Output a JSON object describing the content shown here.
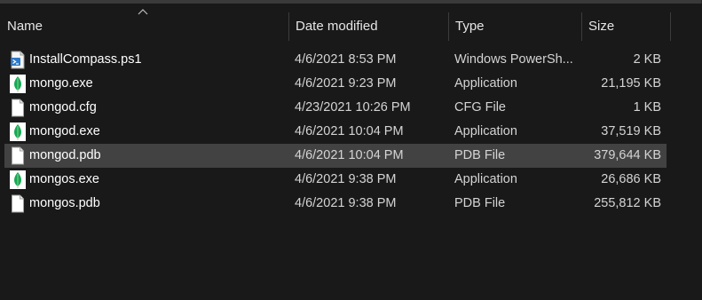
{
  "columns": {
    "name": "Name",
    "date_modified": "Date modified",
    "type": "Type",
    "size": "Size"
  },
  "sort": {
    "column": "Name",
    "direction": "ascending",
    "icon": "sort-up-arrow-icon"
  },
  "files": [
    {
      "name": "InstallCompass.ps1",
      "date": "4/6/2021 8:53 PM",
      "type": "Windows PowerSh...",
      "size": "2 KB",
      "icon": "powershell-script-icon",
      "selected": false
    },
    {
      "name": "mongo.exe",
      "date": "4/6/2021 9:23 PM",
      "type": "Application",
      "size": "21,195 KB",
      "icon": "mongodb-leaf-icon",
      "selected": false
    },
    {
      "name": "mongod.cfg",
      "date": "4/23/2021 10:26 PM",
      "type": "CFG File",
      "size": "1 KB",
      "icon": "document-icon",
      "selected": false
    },
    {
      "name": "mongod.exe",
      "date": "4/6/2021 10:04 PM",
      "type": "Application",
      "size": "37,519 KB",
      "icon": "mongodb-leaf-icon",
      "selected": false
    },
    {
      "name": "mongod.pdb",
      "date": "4/6/2021 10:04 PM",
      "type": "PDB File",
      "size": "379,644 KB",
      "icon": "document-icon",
      "selected": true
    },
    {
      "name": "mongos.exe",
      "date": "4/6/2021 9:38 PM",
      "type": "Application",
      "size": "26,686 KB",
      "icon": "mongodb-leaf-icon",
      "selected": false
    },
    {
      "name": "mongos.pdb",
      "date": "4/6/2021 9:38 PM",
      "type": "PDB File",
      "size": "255,812 KB",
      "icon": "document-icon",
      "selected": false
    }
  ],
  "colors": {
    "background": "#191919",
    "selected_row": "#424242",
    "header_text": "#e6e6e6",
    "column_separator": "#3c3c3c",
    "leaf_green": "#13aa52"
  }
}
